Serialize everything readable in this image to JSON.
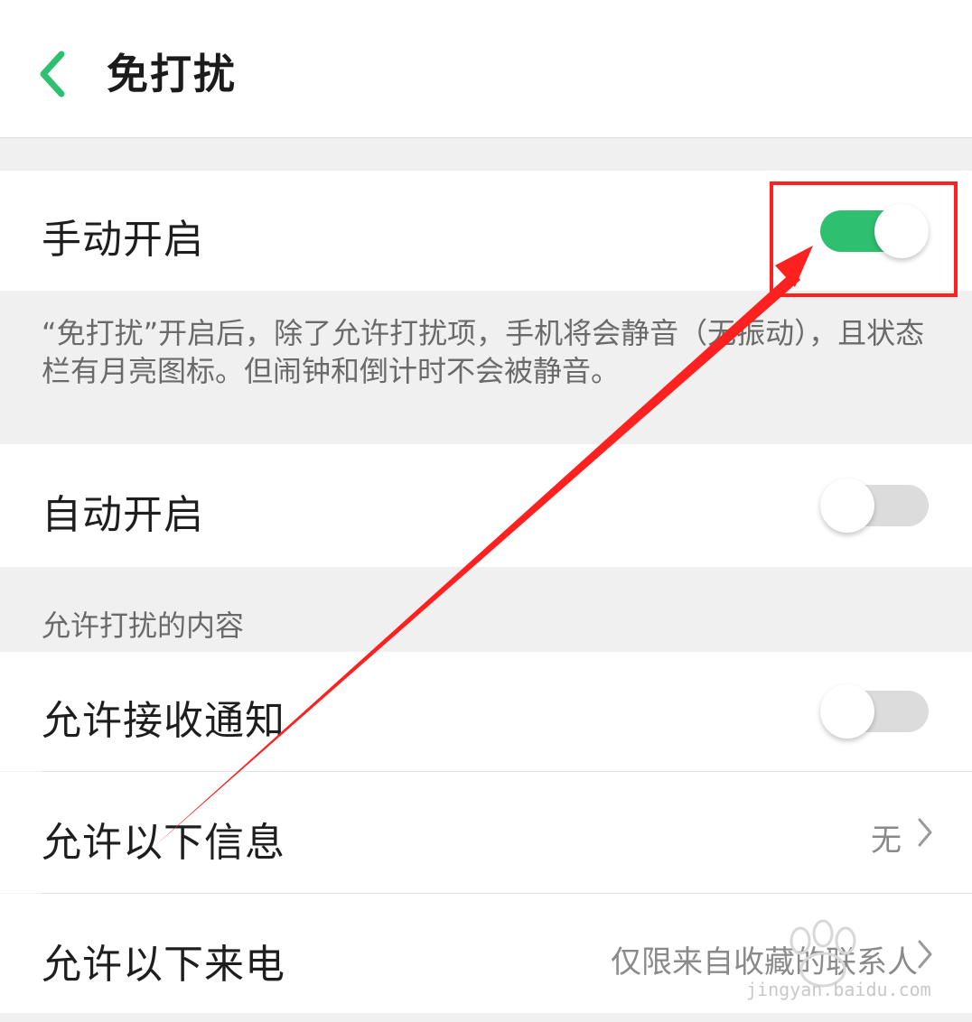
{
  "header": {
    "title": "免打扰"
  },
  "manual": {
    "label": "手动开启",
    "enabled": true
  },
  "description": "“免打扰”开启后，除了允许打扰项，手机将会静音（无振动），且状态栏有月亮图标。但闹钟和倒计时不会被静音。",
  "auto": {
    "label": "自动开启",
    "enabled": false
  },
  "section": {
    "title": "允许打扰的内容"
  },
  "allow_notifications": {
    "label": "允许接收通知",
    "enabled": false
  },
  "allow_messages": {
    "label": "允许以下信息",
    "value": "无"
  },
  "allow_calls": {
    "label": "允许以下来电",
    "value": "仅限来自收藏的联系人"
  },
  "colors": {
    "accent": "#2fbf71",
    "annotation": "#ff2020"
  },
  "icons": {
    "back": "chevron-left-icon",
    "row_arrow": "chevron-right-icon"
  },
  "watermark": {
    "text": "jingyan.baidu.com"
  }
}
